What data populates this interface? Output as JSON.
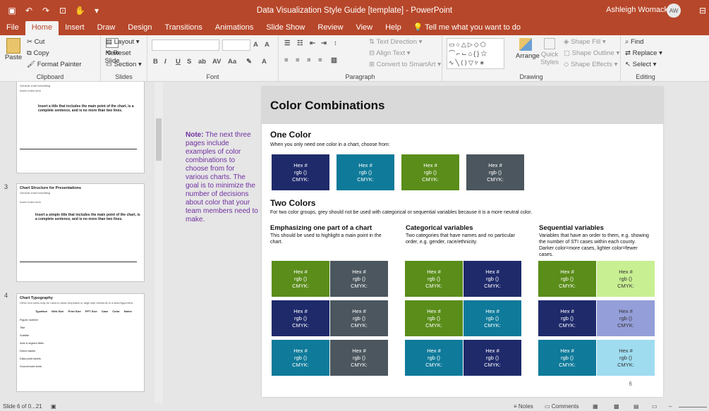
{
  "window": {
    "title": "Data Visualization Style Guide [template]  -  PowerPoint",
    "user": "Ashleigh Womack",
    "initials": "AW"
  },
  "tabs": [
    "File",
    "Home",
    "Insert",
    "Draw",
    "Design",
    "Transitions",
    "Animations",
    "Slide Show",
    "Review",
    "View",
    "Help"
  ],
  "tell_me": "Tell me what you want to do",
  "ribbon": {
    "clipboard": {
      "paste": "Paste",
      "cut": "Cut",
      "copy": "Copy",
      "format_painter": "Format Painter",
      "label": "Clipboard"
    },
    "slides": {
      "new_slide": "New Slide",
      "layout": "Layout",
      "reset": "Reset",
      "section": "Section",
      "label": "Slides"
    },
    "font": {
      "label": "Font"
    },
    "paragraph": {
      "text_direction": "Text Direction",
      "align_text": "Align Text",
      "convert": "Convert to SmartArt",
      "label": "Paragraph"
    },
    "drawing": {
      "arrange": "Arrange",
      "quick_styles": "Quick Styles",
      "shape_fill": "Shape Fill",
      "shape_outline": "Shape Outline",
      "shape_effects": "Shape Effects",
      "label": "Drawing"
    },
    "editing": {
      "find": "Find",
      "replace": "Replace",
      "select": "Select",
      "label": "Editing"
    }
  },
  "thumbnails": [
    {
      "title": "",
      "sub": "General chart formatting",
      "extra": "Insert notes here",
      "text": "Insert a title that includes the main point of the chart, is a complete sentence, and is no more than two lines."
    },
    {
      "num": "3",
      "title": "Chart Structure for Presentations",
      "sub": "General chart formatting",
      "extra": "Insert notes here",
      "text": "Insert a simple title that includes the main point of the chart, is a complete sentence, and is no more than two lines."
    },
    {
      "num": "4",
      "title": "Chart Typography",
      "sub": "Other font sizes may be used to allow emphasis or align with elements in a slide/figure/text.",
      "headers": [
        "Typeface",
        "Web Size",
        "Print Size",
        "PPT Size",
        "Case",
        "Color",
        "Notes"
      ],
      "rows": [
        "Figure number",
        "Title",
        "Subtitle",
        "Axis & legend titles",
        "Direct labels",
        "Data point labels",
        "Source/note texts"
      ]
    }
  ],
  "note": {
    "lead": "Note:",
    "body": " The next three pages include examples of color combinations to choose from for various charts. The goal is to minimize the number of decisions about color that your team members need to make."
  },
  "slide": {
    "title": "Color Combinations",
    "one_color": {
      "heading": "One Color",
      "desc": "When you only need one color in a chart, choose from:"
    },
    "two_colors": {
      "heading": "Two Colors",
      "desc": "For two color groups, grey should not be used with categorical or sequential variables because it is a more neutral color."
    },
    "columns": [
      {
        "heading": "Emphasizing one part of  a chart",
        "desc": "This should be used to highlight a main point in the chart."
      },
      {
        "heading": "Categorical variables",
        "desc": "Two categories that have names and no particular order, e.g. gender, race/ethnicity."
      },
      {
        "heading": "Sequential variables",
        "desc": "Variables that have an order to them, e.g. showing the number of STI cases within each county. Darker color=more cases, lighter color=fewer cases."
      }
    ],
    "swatch": {
      "hex": "Hex #",
      "rgb": "rgb ()",
      "cmyk": "CMYK:"
    },
    "page_number": "6",
    "colors": {
      "navy": "#1f2a6b",
      "teal": "#0f7a9a",
      "green": "#5a8d1a",
      "slate": "#4b565e",
      "light_green": "#c9ef93",
      "lavender": "#949ed8",
      "light_blue": "#9fdcf0"
    }
  },
  "status": {
    "slide": "Slide 6 of 0...21",
    "notes": "Notes",
    "comments": "Comments"
  }
}
